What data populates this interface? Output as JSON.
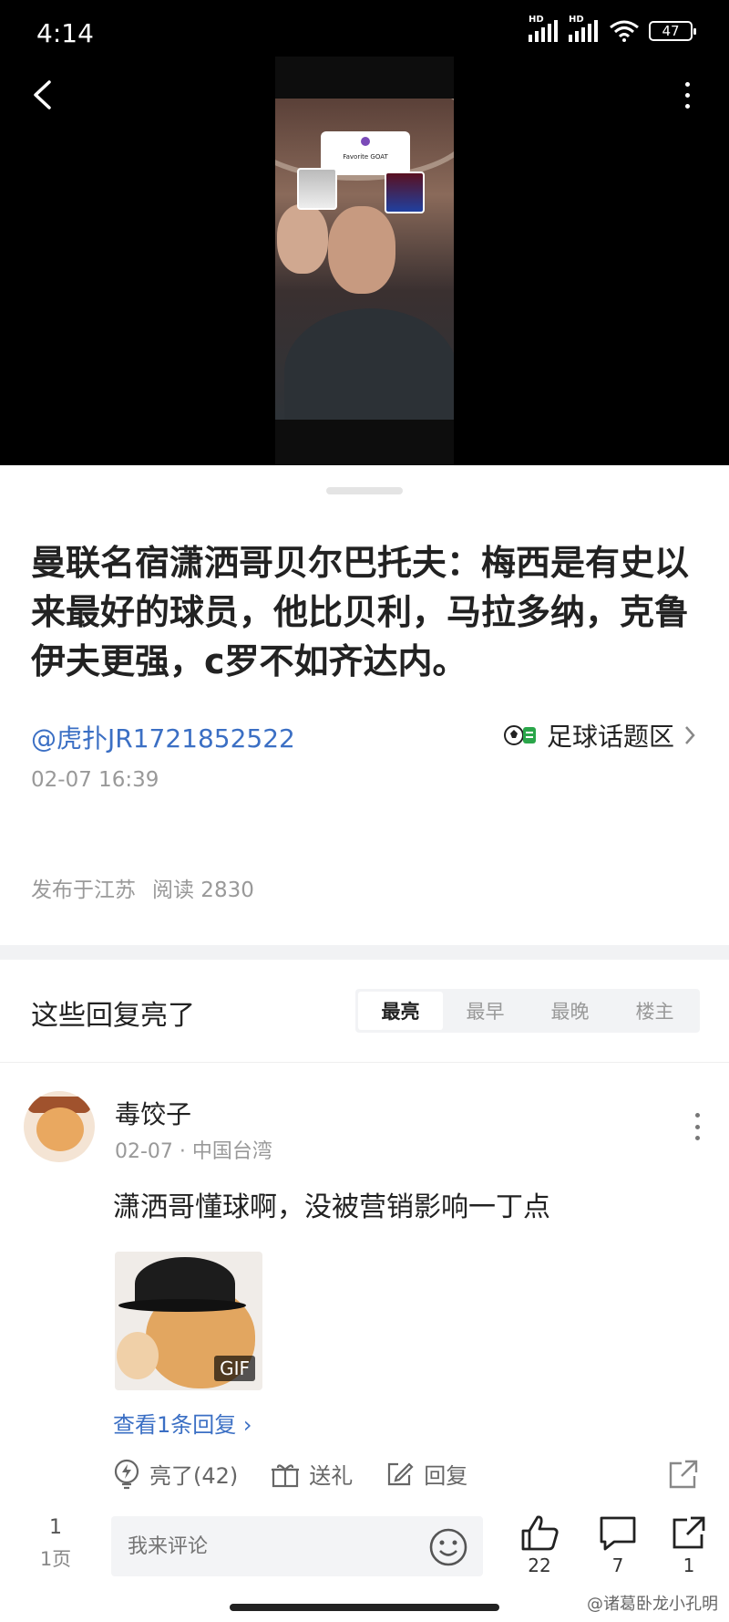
{
  "status_bar": {
    "time": "4:14",
    "battery": "47",
    "signal_badge": "HD"
  },
  "video": {
    "card_text": "Favorite GOAT"
  },
  "post": {
    "title": "曼联名宿潇洒哥贝尔巴托夫：梅西是有史以来最好的球员，他比贝利，马拉多纳，克鲁伊夫更强，c罗不如齐达内。",
    "author": "@虎扑JR1721852522",
    "topic": "足球话题区",
    "time": "02-07 16:39",
    "location": "发布于江苏",
    "reads": "阅读 2830"
  },
  "replies": {
    "heading": "这些回复亮了",
    "sort_tabs": [
      "最亮",
      "最早",
      "最晚",
      "楼主"
    ],
    "active_tab": "最亮"
  },
  "comment": {
    "username": "毒饺子",
    "meta": "02-07 · 中国台湾",
    "text": "潇洒哥懂球啊，没被营销影响一丁点",
    "gif_badge": "GIF",
    "view_replies": "查看1条回复 ›",
    "actions": {
      "light": "亮了(42)",
      "gift": "送礼",
      "reply": "回复"
    }
  },
  "bottom_bar": {
    "page_num": "1",
    "page_label": "1页",
    "input_placeholder": "我来评论",
    "likes": "22",
    "comments": "7",
    "shares": "1"
  },
  "watermark": "@诸葛卧龙小孔明",
  "colors": {
    "link": "#3b6fc4",
    "bg_dark": "#000000",
    "divider": "#f1f2f4"
  }
}
